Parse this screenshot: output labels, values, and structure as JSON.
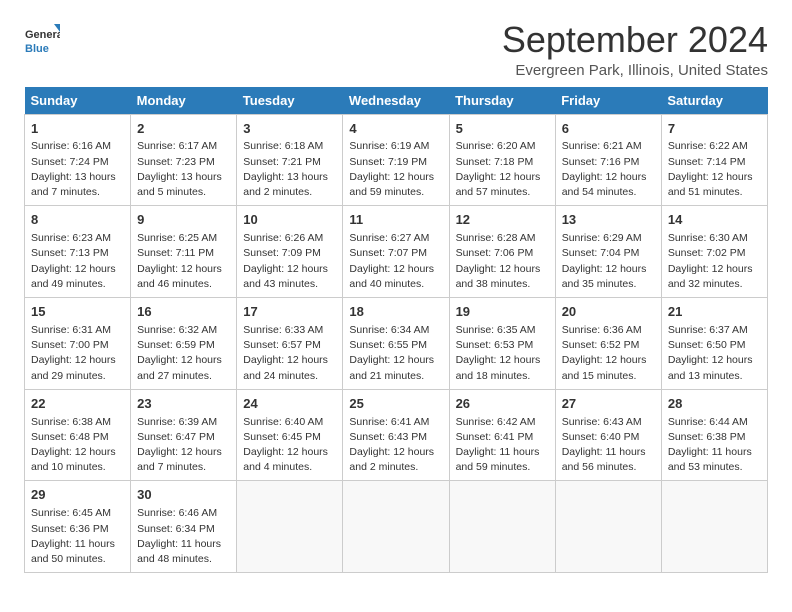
{
  "logo": {
    "line1": "General",
    "line2": "Blue"
  },
  "title": "September 2024",
  "location": "Evergreen Park, Illinois, United States",
  "weekdays": [
    "Sunday",
    "Monday",
    "Tuesday",
    "Wednesday",
    "Thursday",
    "Friday",
    "Saturday"
  ],
  "weeks": [
    [
      {
        "day": "1",
        "info": "Sunrise: 6:16 AM\nSunset: 7:24 PM\nDaylight: 13 hours\nand 7 minutes."
      },
      {
        "day": "2",
        "info": "Sunrise: 6:17 AM\nSunset: 7:23 PM\nDaylight: 13 hours\nand 5 minutes."
      },
      {
        "day": "3",
        "info": "Sunrise: 6:18 AM\nSunset: 7:21 PM\nDaylight: 13 hours\nand 2 minutes."
      },
      {
        "day": "4",
        "info": "Sunrise: 6:19 AM\nSunset: 7:19 PM\nDaylight: 12 hours\nand 59 minutes."
      },
      {
        "day": "5",
        "info": "Sunrise: 6:20 AM\nSunset: 7:18 PM\nDaylight: 12 hours\nand 57 minutes."
      },
      {
        "day": "6",
        "info": "Sunrise: 6:21 AM\nSunset: 7:16 PM\nDaylight: 12 hours\nand 54 minutes."
      },
      {
        "day": "7",
        "info": "Sunrise: 6:22 AM\nSunset: 7:14 PM\nDaylight: 12 hours\nand 51 minutes."
      }
    ],
    [
      {
        "day": "8",
        "info": "Sunrise: 6:23 AM\nSunset: 7:13 PM\nDaylight: 12 hours\nand 49 minutes."
      },
      {
        "day": "9",
        "info": "Sunrise: 6:25 AM\nSunset: 7:11 PM\nDaylight: 12 hours\nand 46 minutes."
      },
      {
        "day": "10",
        "info": "Sunrise: 6:26 AM\nSunset: 7:09 PM\nDaylight: 12 hours\nand 43 minutes."
      },
      {
        "day": "11",
        "info": "Sunrise: 6:27 AM\nSunset: 7:07 PM\nDaylight: 12 hours\nand 40 minutes."
      },
      {
        "day": "12",
        "info": "Sunrise: 6:28 AM\nSunset: 7:06 PM\nDaylight: 12 hours\nand 38 minutes."
      },
      {
        "day": "13",
        "info": "Sunrise: 6:29 AM\nSunset: 7:04 PM\nDaylight: 12 hours\nand 35 minutes."
      },
      {
        "day": "14",
        "info": "Sunrise: 6:30 AM\nSunset: 7:02 PM\nDaylight: 12 hours\nand 32 minutes."
      }
    ],
    [
      {
        "day": "15",
        "info": "Sunrise: 6:31 AM\nSunset: 7:00 PM\nDaylight: 12 hours\nand 29 minutes."
      },
      {
        "day": "16",
        "info": "Sunrise: 6:32 AM\nSunset: 6:59 PM\nDaylight: 12 hours\nand 27 minutes."
      },
      {
        "day": "17",
        "info": "Sunrise: 6:33 AM\nSunset: 6:57 PM\nDaylight: 12 hours\nand 24 minutes."
      },
      {
        "day": "18",
        "info": "Sunrise: 6:34 AM\nSunset: 6:55 PM\nDaylight: 12 hours\nand 21 minutes."
      },
      {
        "day": "19",
        "info": "Sunrise: 6:35 AM\nSunset: 6:53 PM\nDaylight: 12 hours\nand 18 minutes."
      },
      {
        "day": "20",
        "info": "Sunrise: 6:36 AM\nSunset: 6:52 PM\nDaylight: 12 hours\nand 15 minutes."
      },
      {
        "day": "21",
        "info": "Sunrise: 6:37 AM\nSunset: 6:50 PM\nDaylight: 12 hours\nand 13 minutes."
      }
    ],
    [
      {
        "day": "22",
        "info": "Sunrise: 6:38 AM\nSunset: 6:48 PM\nDaylight: 12 hours\nand 10 minutes."
      },
      {
        "day": "23",
        "info": "Sunrise: 6:39 AM\nSunset: 6:47 PM\nDaylight: 12 hours\nand 7 minutes."
      },
      {
        "day": "24",
        "info": "Sunrise: 6:40 AM\nSunset: 6:45 PM\nDaylight: 12 hours\nand 4 minutes."
      },
      {
        "day": "25",
        "info": "Sunrise: 6:41 AM\nSunset: 6:43 PM\nDaylight: 12 hours\nand 2 minutes."
      },
      {
        "day": "26",
        "info": "Sunrise: 6:42 AM\nSunset: 6:41 PM\nDaylight: 11 hours\nand 59 minutes."
      },
      {
        "day": "27",
        "info": "Sunrise: 6:43 AM\nSunset: 6:40 PM\nDaylight: 11 hours\nand 56 minutes."
      },
      {
        "day": "28",
        "info": "Sunrise: 6:44 AM\nSunset: 6:38 PM\nDaylight: 11 hours\nand 53 minutes."
      }
    ],
    [
      {
        "day": "29",
        "info": "Sunrise: 6:45 AM\nSunset: 6:36 PM\nDaylight: 11 hours\nand 50 minutes."
      },
      {
        "day": "30",
        "info": "Sunrise: 6:46 AM\nSunset: 6:34 PM\nDaylight: 11 hours\nand 48 minutes."
      },
      {
        "day": "",
        "info": ""
      },
      {
        "day": "",
        "info": ""
      },
      {
        "day": "",
        "info": ""
      },
      {
        "day": "",
        "info": ""
      },
      {
        "day": "",
        "info": ""
      }
    ]
  ]
}
